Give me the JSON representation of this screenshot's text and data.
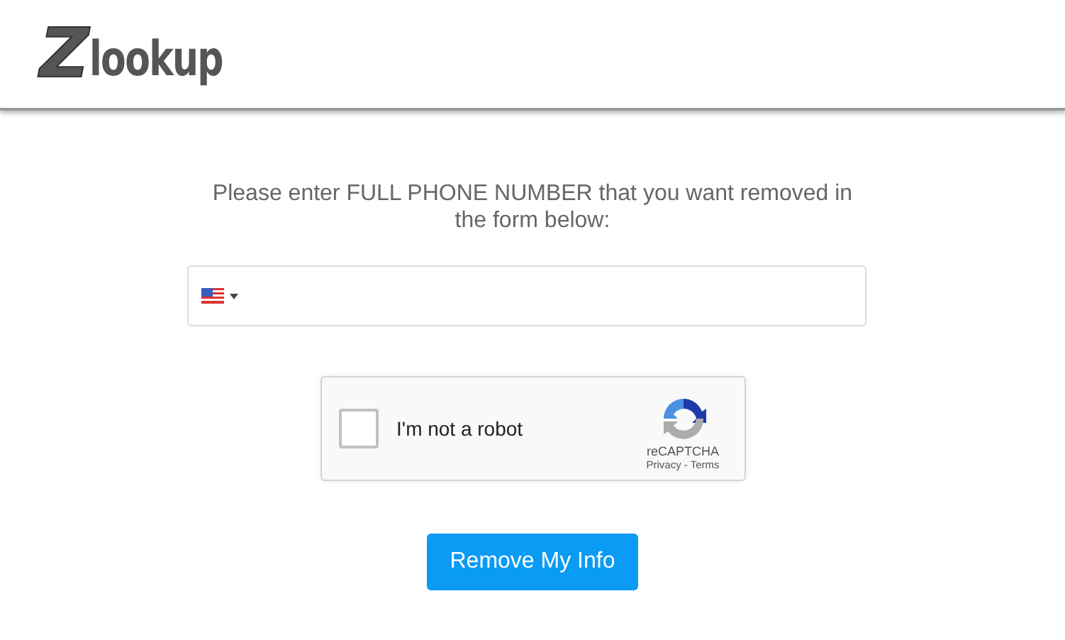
{
  "logo": {
    "mark": "Z",
    "text": "lookup"
  },
  "instructions": "Please enter FULL PHONE NUMBER that you want removed in the form below:",
  "phone_field": {
    "flag": {
      "kind": "us"
    }
  },
  "captcha": {
    "label": "I'm not a robot",
    "checked": false,
    "brand": "reCAPTCHA",
    "links": [
      "Privacy",
      "Terms"
    ],
    "separator": "-"
  },
  "submit_button": "Remove My Info"
}
